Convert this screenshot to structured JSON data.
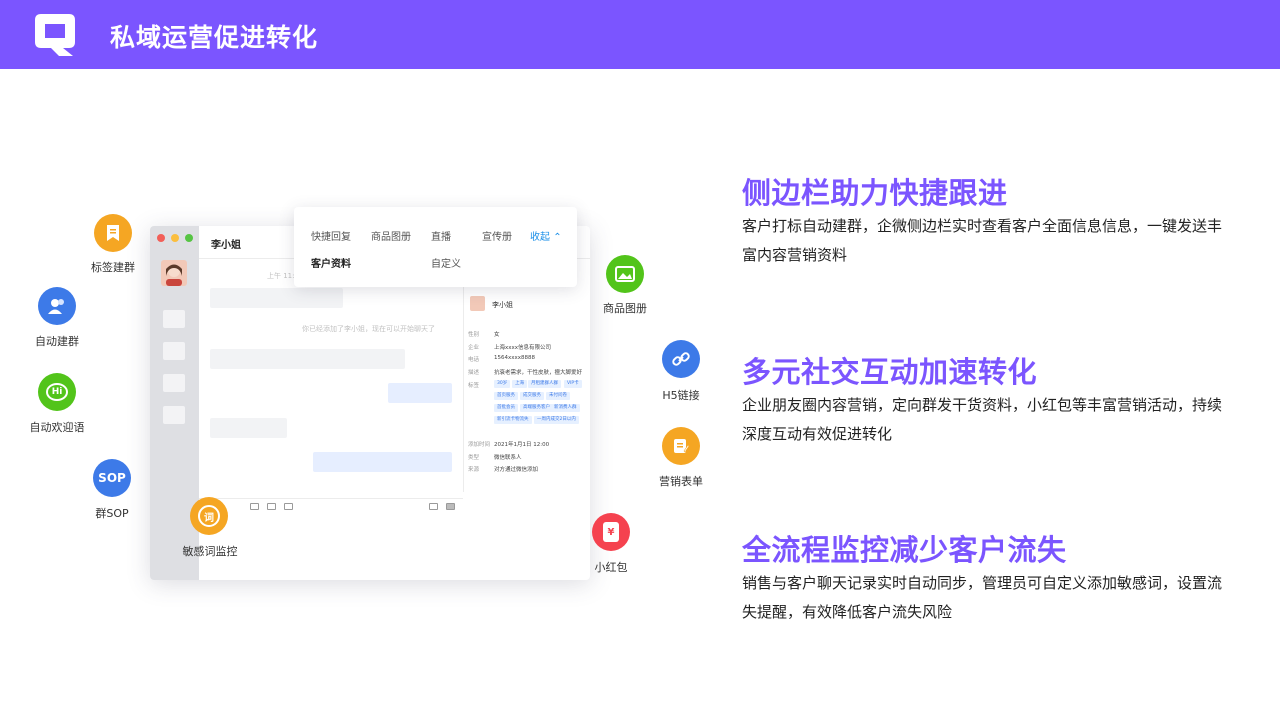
{
  "header": {
    "title": "私域运营促进转化"
  },
  "mockup": {
    "contact_name": "李小姐",
    "time_text": "上午 11:",
    "system_msg": "你已经添加了李小姐，现在可以开始聊天了",
    "popup": {
      "items": [
        "快捷回复",
        "商品图册",
        "直播",
        "宣传册",
        "收起"
      ],
      "items_row2": [
        "客户资料",
        "自定义"
      ]
    },
    "panel": {
      "name": "李小姐",
      "fields": [
        {
          "k": "性别",
          "v": "女"
        },
        {
          "k": "企业",
          "v": "上海xxxx信息有限公司"
        },
        {
          "k": "电话",
          "v": "1564xxxx8888"
        },
        {
          "k": "描述",
          "v": "抗衰老需求，干性皮肤，擅大脚爱好"
        },
        {
          "k": "标签",
          "v": ""
        }
      ],
      "tags": [
        "30岁",
        "上海",
        "月租建群人群",
        "VIP卡",
        "首页服务",
        "成交服务",
        "未付问卷",
        "首批会员",
        "高端服务客户",
        "新消费人群",
        "新引流卡物流失",
        "一周内成交2日以内"
      ],
      "meta": [
        {
          "k": "添加时间",
          "v": "2021年1月1日 12:00"
        },
        {
          "k": "类型",
          "v": "微信联系人"
        },
        {
          "k": "来源",
          "v": "对方通过微信添加"
        }
      ]
    }
  },
  "features": {
    "tag_group": "标签建群",
    "auto_group": "自动建群",
    "welcome": "自动欢迎语",
    "welcome_icon_text": "Hi",
    "group_sop": "群SOP",
    "sop_icon_text": "SOP",
    "sensitive": "敏感词监控",
    "sensitive_icon_text": "词",
    "catalog": "商品图册",
    "h5": "H5链接",
    "form": "营销表单",
    "redpacket": "小红包",
    "redpacket_icon_text": "¥"
  },
  "sections": [
    {
      "title": "侧边栏助力快捷跟进",
      "desc": "客户打标自动建群，企微侧边栏实时查看客户全面信息信息，一键发送丰富内容营销资料"
    },
    {
      "title": "多元社交互动加速转化",
      "desc": "企业朋友圈内容营销，定向群发干货资料，小红包等丰富营销活动，持续深度互动有效促进转化"
    },
    {
      "title": "全流程监控减少客户流失",
      "desc": "销售与客户聊天记录实时自动同步，管理员可自定义添加敏感词，设置流失提醒，有效降低客户流失风险"
    }
  ],
  "colors": {
    "brand": "#7b55ff",
    "orange": "#f5a623",
    "blue": "#3d7ae8",
    "green": "#52c41a",
    "red": "#f5424f"
  }
}
